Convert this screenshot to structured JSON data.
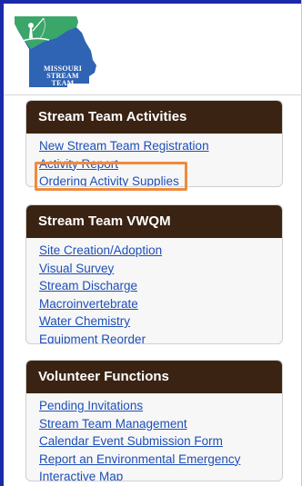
{
  "logo": {
    "line1": "MISSOURI",
    "line2": "STREAM",
    "line3": "TEAM"
  },
  "panels": [
    {
      "title": "Stream Team Activities",
      "links": [
        "New Stream Team Registration",
        "Activity Report",
        "Ordering Activity Supplies"
      ]
    },
    {
      "title": "Stream Team VWQM",
      "links": [
        "Site Creation/Adoption",
        "Visual Survey",
        "Stream Discharge",
        "Macroinvertebrate",
        "Water Chemistry",
        "Equipment Reorder"
      ]
    },
    {
      "title": "Volunteer Functions",
      "links": [
        "Pending Invitations",
        "Stream Team Management",
        "Calendar Event Submission Form",
        "Report an Environmental Emergency",
        "Interactive Map"
      ]
    }
  ],
  "colors": {
    "accent_blue": "#1b2aa8",
    "panel_header": "#3a2313",
    "link": "#1e4fb8",
    "highlight": "#f08a3c",
    "logo_green": "#3aa66a",
    "logo_blue": "#2f63b3"
  }
}
